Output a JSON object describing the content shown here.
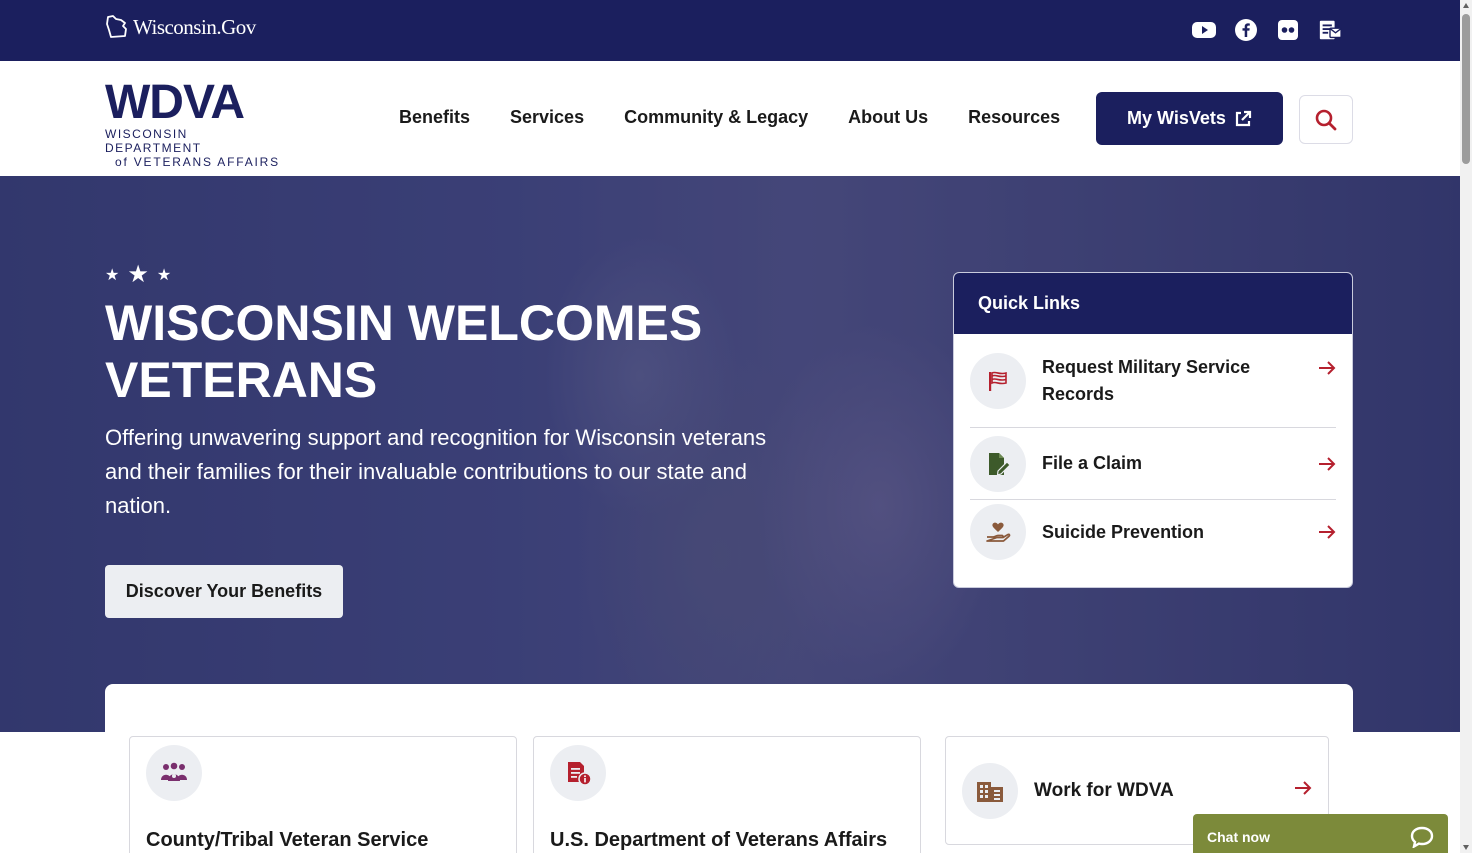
{
  "topbar": {
    "site_brand": "Wisconsin.Gov",
    "social_icons": [
      "youtube-icon",
      "facebook-icon",
      "flickr-icon",
      "newsletter-icon"
    ]
  },
  "header": {
    "logo": {
      "mark": "WDVA",
      "line1": "WISCONSIN DEPARTMENT",
      "line2": "of VETERANS AFFAIRS"
    },
    "nav": [
      "Benefits",
      "Services",
      "Community & Legacy",
      "About Us",
      "Resources"
    ],
    "cta_label": "My WisVets",
    "search_icon": "search-icon"
  },
  "hero": {
    "title": "WISCONSIN WELCOMES VETERANS",
    "subtitle": "Offering unwavering support and recognition for Wisconsin veterans and their families for their invaluable contributions to our state and nation.",
    "button_label": "Discover Your Benefits"
  },
  "quick_links": {
    "title": "Quick Links",
    "items": [
      {
        "label": "Request Military Service Records",
        "icon": "flag-icon"
      },
      {
        "label": "File a Claim",
        "icon": "file-edit-icon"
      },
      {
        "label": "Suicide Prevention",
        "icon": "hand-heart-icon"
      }
    ]
  },
  "cards": [
    {
      "title": "County/Tribal Veteran Service",
      "icon": "people-group-icon"
    },
    {
      "title": "U.S. Department of Veterans Affairs",
      "icon": "document-info-icon"
    },
    {
      "title": "Work for WDVA",
      "icon": "building-icon"
    }
  ],
  "chat": {
    "label": "Chat now",
    "icon": "chat-bubble-icon"
  },
  "colors": {
    "navy": "#1b1f5e",
    "accent_red": "#b5202e",
    "chat_olive": "#7c8a3a",
    "icon_bg": "#eceef2",
    "purple_icon": "#7a2f6e",
    "brown_icon": "#8a5a3c",
    "green_icon": "#3d5a2a"
  }
}
